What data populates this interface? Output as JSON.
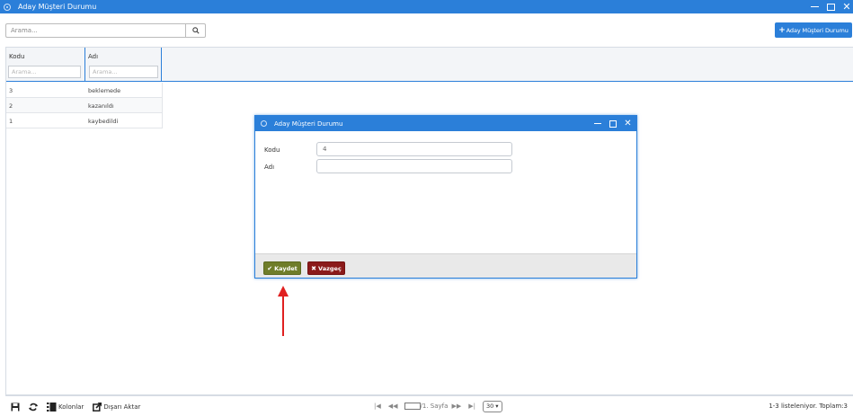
{
  "window": {
    "title": "Aday Müşteri Durumu",
    "close_glyph": "✕"
  },
  "toolbar": {
    "search_placeholder": "Arama...",
    "add_button_label": "Aday Müşteri Durumu",
    "add_button_plus": "+"
  },
  "grid": {
    "columns": [
      {
        "label": "Kodu",
        "filter_placeholder": "Arama..."
      },
      {
        "label": "Adı",
        "filter_placeholder": "Arama..."
      }
    ],
    "rows": [
      {
        "kodu": "3",
        "adi": "beklemede"
      },
      {
        "kodu": "2",
        "adi": "kazanıldı"
      },
      {
        "kodu": "1",
        "adi": "kaybedildi"
      }
    ]
  },
  "pager": {
    "columns_label": "Kolonlar",
    "export_label": "Dışarı Aktar",
    "nav_first": "|◀",
    "nav_prev": "◀◀",
    "page_text": "/1. Sayfa",
    "nav_next": "▶▶",
    "nav_last": "▶|",
    "page_size": "30",
    "dropdown_glyph": "▾",
    "summary": "1-3 listeleniyor. Toplam:3"
  },
  "modal": {
    "title": "Aday Müşteri Durumu",
    "close_glyph": "✕",
    "fields": {
      "kodu_label": "Kodu",
      "kodu_value": "4",
      "adi_label": "Adı",
      "adi_value": ""
    },
    "save_label": "Kaydet",
    "save_icon_glyph": "✔",
    "cancel_label": "Vazgeç",
    "cancel_icon_glyph": "✖"
  },
  "colors": {
    "primary": "#2b7fd9",
    "save": "#6f7d2a",
    "cancel": "#8b1a1a",
    "arrow": "#e02020"
  }
}
